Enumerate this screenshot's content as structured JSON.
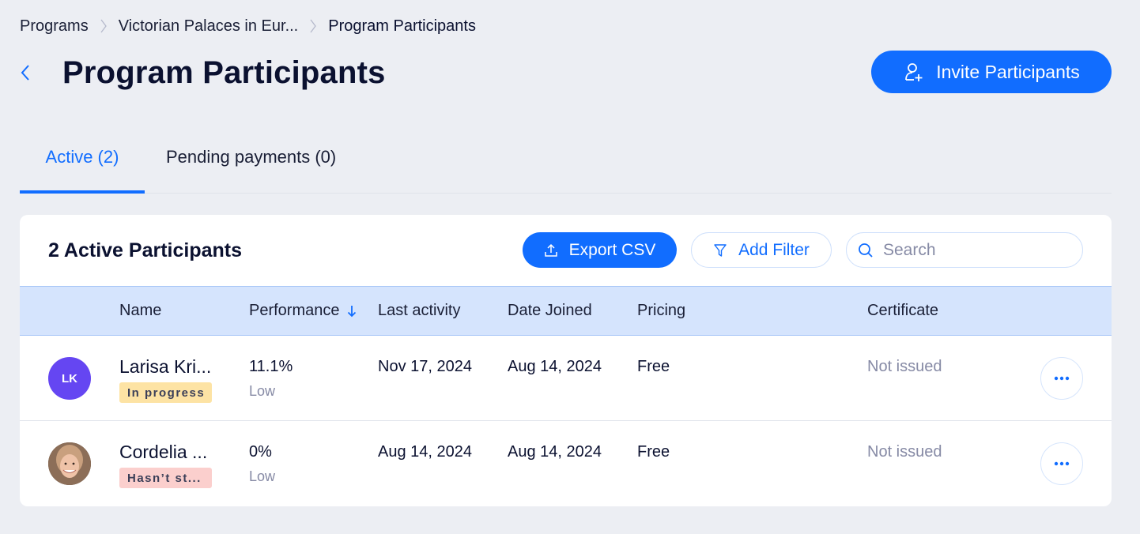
{
  "breadcrumb": {
    "items": [
      "Programs",
      "Victorian Palaces in Eur...",
      "Program Participants"
    ]
  },
  "header": {
    "title": "Program Participants",
    "invite_label": "Invite Participants"
  },
  "tabs": [
    {
      "label": "Active (2)",
      "active": true
    },
    {
      "label": "Pending payments (0)",
      "active": false
    }
  ],
  "card": {
    "title": "2 Active Participants",
    "export_label": "Export CSV",
    "filter_label": "Add Filter",
    "search_placeholder": "Search"
  },
  "table": {
    "columns": [
      "Name",
      "Performance",
      "Last activity",
      "Date Joined",
      "Pricing",
      "Certificate"
    ],
    "sorted_by": "Performance",
    "rows": [
      {
        "avatar_initials": "LK",
        "avatar_type": "initials",
        "name": "Larisa Kri...",
        "status": "In progress",
        "performance": "11.1%",
        "performance_level": "Low",
        "last_activity": "Nov 17, 2024",
        "date_joined": "Aug 14, 2024",
        "pricing": "Free",
        "certificate": "Not issued"
      },
      {
        "avatar_initials": "",
        "avatar_type": "photo",
        "name": "Cordelia ...",
        "status": "Hasn’t st...",
        "performance": "0%",
        "performance_level": "Low",
        "last_activity": "Aug 14, 2024",
        "date_joined": "Aug 14, 2024",
        "pricing": "Free",
        "certificate": "Not issued"
      }
    ]
  },
  "colors": {
    "accent": "#116dff",
    "background": "#eceef3",
    "header_row": "#d5e4fd",
    "badge_in_progress": "#fde3a4",
    "badge_not_started": "#fbcfcd",
    "avatar_initials_bg": "#6546f2"
  }
}
